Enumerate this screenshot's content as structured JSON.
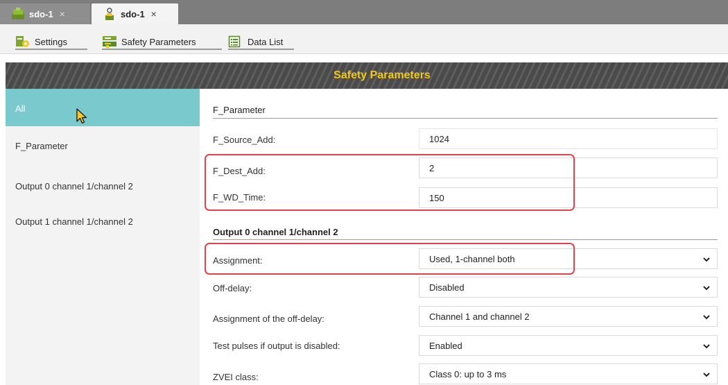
{
  "tabs": [
    {
      "label": "sdo-1",
      "close": "×",
      "active": false
    },
    {
      "label": "sdo-1",
      "close": "×",
      "active": true
    }
  ],
  "toolbar": {
    "settings": "Settings",
    "safety_parameters": "Safety Parameters",
    "data_list": "Data List"
  },
  "banner_title": "Safety Parameters",
  "sidebar": {
    "items": [
      "All",
      "F_Parameter",
      "Output 0 channel 1/channel 2",
      "Output 1 channel 1/channel 2"
    ],
    "selected": "All"
  },
  "sections": {
    "f_parameter": {
      "title": "F_Parameter",
      "rows": [
        {
          "label": "F_Source_Add:",
          "value": "1024"
        },
        {
          "label": "F_Dest_Add:",
          "value": "2"
        },
        {
          "label": "F_WD_Time:",
          "value": "150"
        }
      ]
    },
    "output0": {
      "title": "Output 0 channel 1/channel 2",
      "rows": [
        {
          "label": "Assignment:",
          "value": "Used, 1-channel both"
        },
        {
          "label": "Off-delay:",
          "value": "Disabled"
        },
        {
          "label": "Assignment of the off-delay:",
          "value": "Channel 1 and channel 2"
        },
        {
          "label": "Test pulses if output is disabled:",
          "value": "Enabled"
        },
        {
          "label": "ZVEI class:",
          "value": "Class 0: up to 3 ms"
        }
      ]
    }
  },
  "colors": {
    "accent": "#7ac9cc",
    "banner_text": "#f2c81e",
    "highlight": "#e4414d"
  }
}
